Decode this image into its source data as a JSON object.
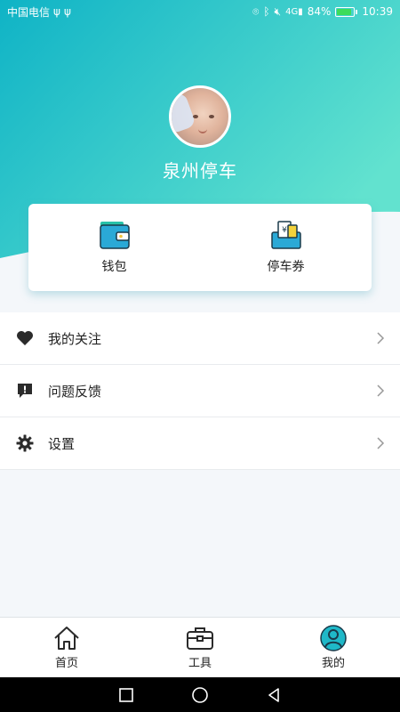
{
  "status_bar": {
    "carrier": "中国电信",
    "battery_percent": "84%",
    "time": "10:39"
  },
  "profile": {
    "name": "泉州停车"
  },
  "quick_actions": [
    {
      "label": "钱包",
      "icon": "wallet-icon"
    },
    {
      "label": "停车券",
      "icon": "parking-coupon-icon"
    }
  ],
  "menu": [
    {
      "label": "我的关注",
      "icon": "heart-icon"
    },
    {
      "label": "问题反馈",
      "icon": "feedback-icon"
    },
    {
      "label": "设置",
      "icon": "gear-icon"
    }
  ],
  "tabs": [
    {
      "label": "首页",
      "icon": "home-icon"
    },
    {
      "label": "工具",
      "icon": "toolbox-icon"
    },
    {
      "label": "我的",
      "icon": "profile-icon",
      "active": true
    }
  ],
  "colors": {
    "gradient_start": "#17b6c8",
    "gradient_end": "#5fe0d0",
    "accent": "#1fb8c8",
    "battery": "#3ddc5a"
  }
}
